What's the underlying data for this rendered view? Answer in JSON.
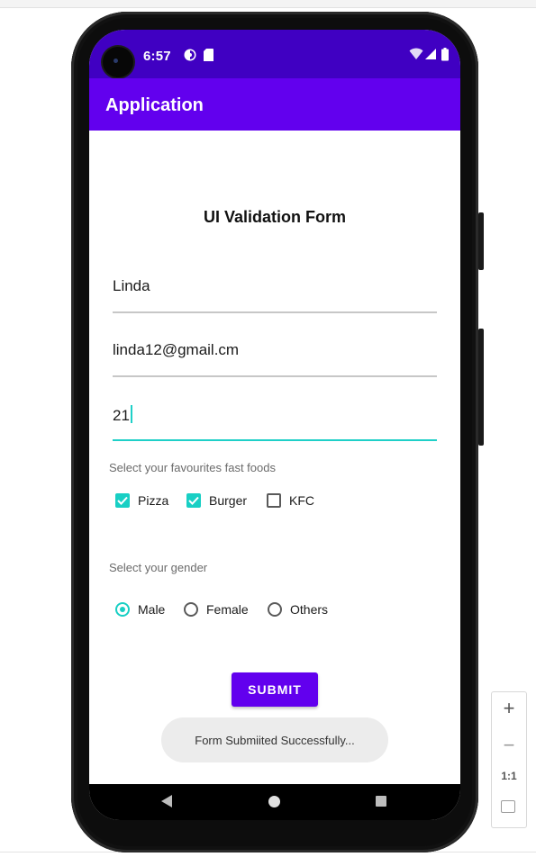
{
  "status_bar": {
    "time": "6:57"
  },
  "app_bar": {
    "title": "Application"
  },
  "form": {
    "title": "UI Validation Form",
    "name_value": "Linda",
    "email_value": "linda12@gmail.cm",
    "age_value": "21",
    "foods_label": "Select your favourites fast foods",
    "foods": [
      {
        "label": "Pizza",
        "checked": true
      },
      {
        "label": "Burger",
        "checked": true
      },
      {
        "label": "KFC",
        "checked": false
      }
    ],
    "gender_label": "Select your gender",
    "genders": [
      {
        "label": "Male",
        "selected": true
      },
      {
        "label": "Female",
        "selected": false
      },
      {
        "label": "Others",
        "selected": false
      }
    ],
    "submit_label": "SUBMIT"
  },
  "toast": {
    "message": "Form Submiited Successfully..."
  },
  "emulator_zoom": {
    "zoom_in": "+",
    "zoom_out": "−",
    "actual_size": "1:1"
  },
  "colors": {
    "status_bar": "#4000c2",
    "app_bar": "#6200ee",
    "accent": "#18cfc4",
    "button": "#6200ee"
  }
}
